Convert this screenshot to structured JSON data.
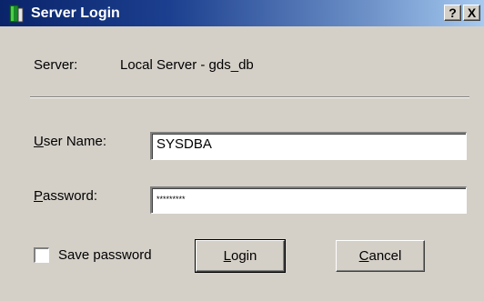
{
  "window": {
    "title": "Server Login",
    "help_label": "?",
    "close_label": "X"
  },
  "server": {
    "label": "Server:",
    "value": "Local Server - gds_db"
  },
  "username": {
    "label_mnemonic": "U",
    "label_rest": "ser Name:",
    "value": "SYSDBA"
  },
  "password": {
    "label_mnemonic": "P",
    "label_rest": "assword:",
    "value": "*********"
  },
  "save_password": {
    "label": "Save password",
    "checked": false
  },
  "buttons": {
    "login_mnemonic": "L",
    "login_rest": "ogin",
    "cancel_mnemonic": "C",
    "cancel_rest": "ancel"
  }
}
